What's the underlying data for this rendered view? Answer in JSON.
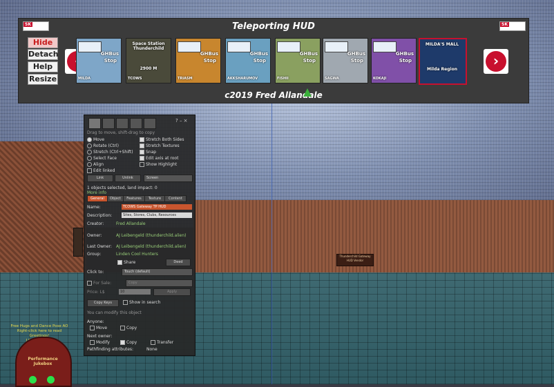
{
  "hud": {
    "title": "Teleporting HUD",
    "footer": "c2019 Fred Allandale",
    "logo_left": {
      "sk": "SK",
      "text": "Skyline Suburban Hub"
    },
    "logo_right": {
      "sk": "SK",
      "text": "Skyline Suburban Hub"
    },
    "buttons": [
      {
        "label": "Hide"
      },
      {
        "label": "Detach"
      },
      {
        "label": "Help"
      },
      {
        "label": "Resize"
      }
    ],
    "prev_arrow": "‹",
    "next_arrow": "›",
    "destinations": [
      {
        "line1": "GHBus",
        "line2": "Stop",
        "place": "MILDA",
        "color": "#7ea6c8"
      },
      {
        "line1": "Space Station Thunderchild",
        "line2": "2900 M",
        "place": "TCOWS",
        "color": "#4a4a3a"
      },
      {
        "line1": "GHBus",
        "line2": "Stop",
        "place": "TRIASM",
        "color": "#c8862e"
      },
      {
        "line1": "GHBus",
        "line2": "Stop",
        "place": "AKKSHARUMOV",
        "color": "#6aa0c0"
      },
      {
        "line1": "GHBus",
        "line2": "Stop",
        "place": "FISHII",
        "color": "#8aa060"
      },
      {
        "line1": "GHBus",
        "line2": "Stop",
        "place": "SAGWA",
        "color": "#a0a8b0"
      },
      {
        "line1": "GHBus",
        "line2": "Stop",
        "place": "KOKAJI",
        "color": "#8050a8"
      },
      {
        "line1": "MILDA'S MALL",
        "line2": "Milda Region",
        "place": "",
        "color": "#1e3a6a"
      }
    ]
  },
  "panel": {
    "hint": "Drag to move, shift-drag to copy",
    "modes": [
      {
        "label": "Move",
        "on": true
      },
      {
        "label": "Rotate (Ctrl)",
        "on": false
      },
      {
        "label": "Stretch (Ctrl+Shift)",
        "on": false
      },
      {
        "label": "Select Face",
        "on": false
      },
      {
        "label": "Align",
        "on": false
      },
      {
        "label": "Edit linked",
        "on": false
      }
    ],
    "options": [
      {
        "label": "Stretch Both Sides",
        "on": true
      },
      {
        "label": "Stretch Textures",
        "on": true
      },
      {
        "label": "Snap",
        "on": true
      },
      {
        "label": "Edit axis at root",
        "on": true
      },
      {
        "label": "Show Highlight",
        "on": false
      }
    ],
    "link_btn": "Link",
    "unlink_btn": "Unlink",
    "ruler_select": "Screen",
    "selected_info": "1 objects selected, land impact: 0",
    "more_info": "More info",
    "tabs": [
      "General",
      "Object",
      "Features",
      "Texture",
      "Content"
    ],
    "name_label": "Name:",
    "name_value": "TCOWS Gateway TP HUD",
    "description_label": "Description:",
    "description_value": "Sites, Stores, Clubs, Resources",
    "creator_label": "Creator:",
    "creator_value": "Fred Allandale",
    "owner_label": "Owner:",
    "owner_value": "AJ Leibengeld (thunderchild.alien)",
    "last_owner_label": "Last Owner:",
    "last_owner_value": "AJ Leibengeld (thunderchild.alien)",
    "group_label": "Group:",
    "group_value": "Linden Cool Hunters",
    "share_label": "Share",
    "deed_btn": "Deed",
    "click_to_label": "Click to:",
    "click_to_value": "Touch (default)",
    "for_sale_label": "For Sale:",
    "for_sale_type": "Copy",
    "price_label": "Price: L$",
    "price_value": "10",
    "apply_btn": "Apply",
    "copy_keys_btn": "Copy Keys",
    "show_in_search": "Show in search",
    "modify_note": "You can modify this object",
    "anyone_label": "Anyone:",
    "anyone_move": "Move",
    "anyone_copy": "Copy",
    "next_owner_label": "Next owner:",
    "next_modify": "Modify",
    "next_copy": "Copy",
    "next_transfer": "Transfer",
    "pathfinding_label": "Pathfinding attributes:",
    "pathfinding_value": "None"
  },
  "scene": {
    "sign_text": "Thunderchild Gateway HUD Vendor",
    "hover_text": "Free Hugs and Dance Pose AO\nRight-click here to read\nGreetings!\nLIVE STREAM!",
    "jukebox_title": "Performance Jukebox"
  }
}
